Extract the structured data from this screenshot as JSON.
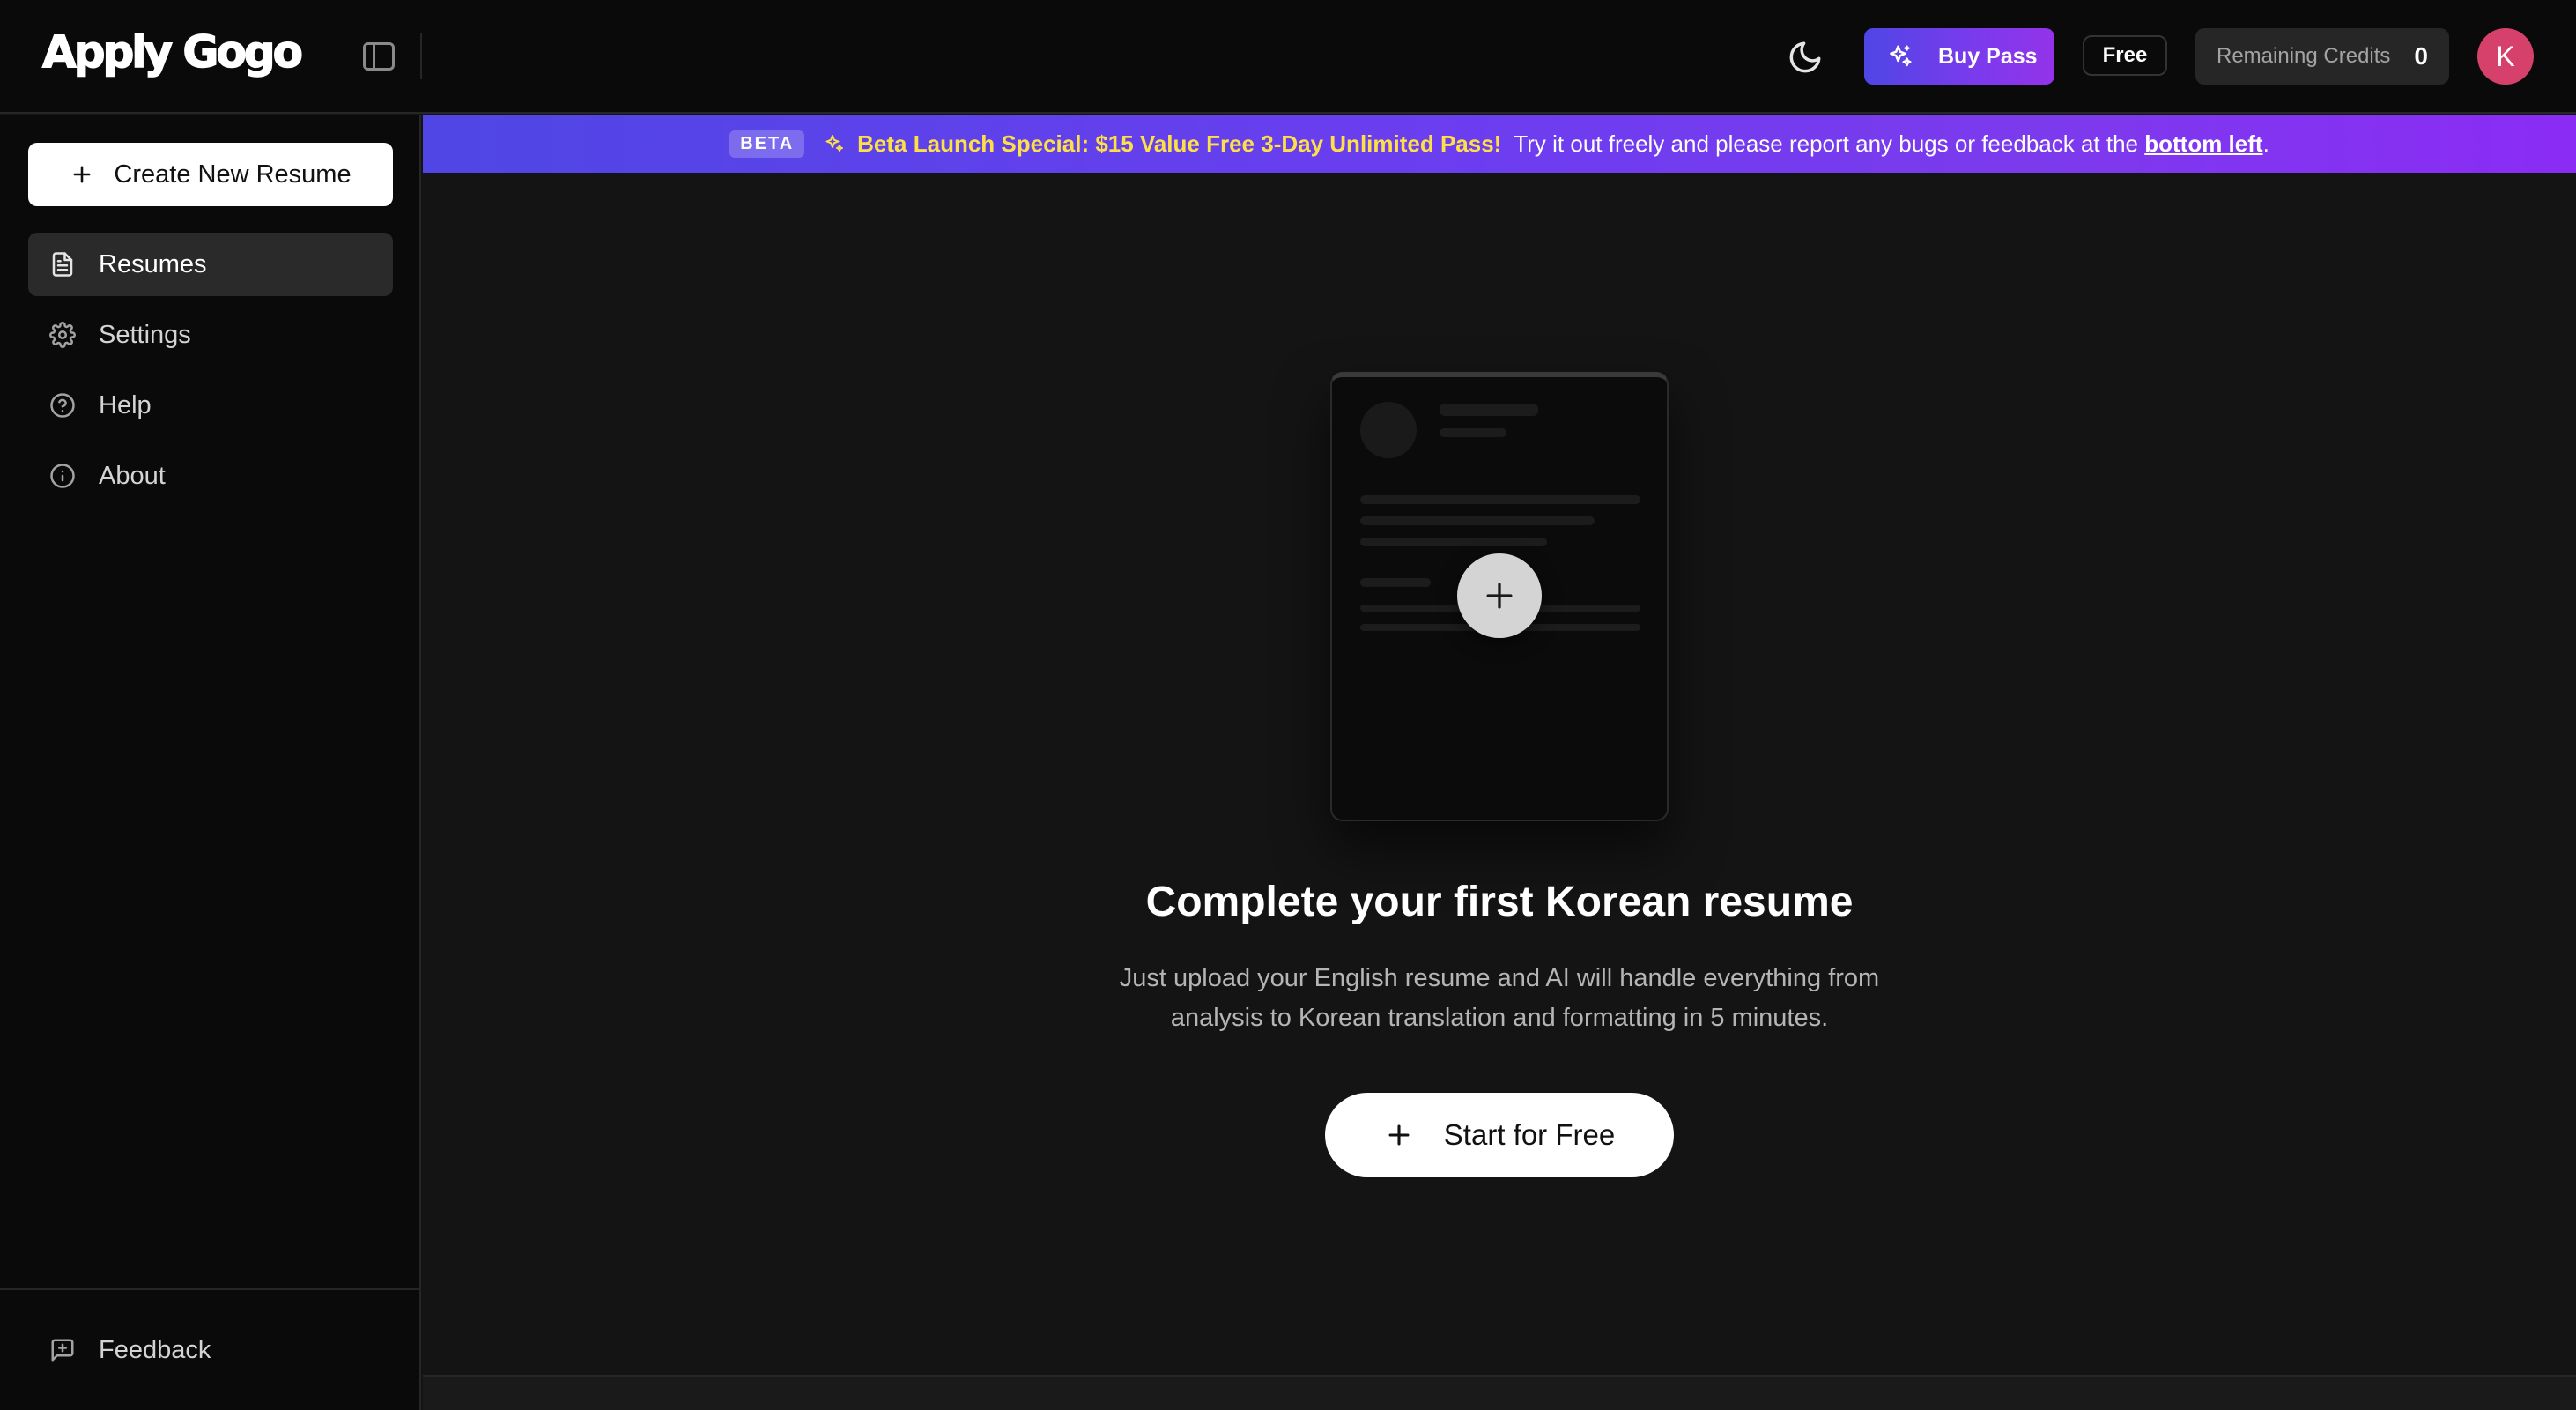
{
  "header": {
    "logo": "Apply Gogo",
    "buy_pass_label": "Buy Pass",
    "plan_label": "Free",
    "credits_label": "Remaining Credits",
    "credits_value": "0",
    "avatar_initial": "K",
    "icons": [
      "sidebar-toggle-icon",
      "moon-icon",
      "sparkles-icon"
    ]
  },
  "sidebar": {
    "create_label": "Create New Resume",
    "items": [
      {
        "label": "Resumes",
        "icon": "document-icon",
        "active": true
      },
      {
        "label": "Settings",
        "icon": "gear-icon",
        "active": false
      },
      {
        "label": "Help",
        "icon": "help-circle-icon",
        "active": false
      },
      {
        "label": "About",
        "icon": "info-icon",
        "active": false
      }
    ],
    "feedback_label": "Feedback"
  },
  "banner": {
    "tag": "BETA",
    "promo": "Beta Launch Special: $15 Value Free 3-Day Unlimited Pass!",
    "text": "Try it out freely and please report any bugs or feedback at the",
    "link": "bottom left",
    "end": "."
  },
  "main": {
    "title": "Complete your first Korean resume",
    "desc_line1": "Just upload your English resume and AI will handle everything from",
    "desc_line2": "analysis to Korean translation and formatting in 5 minutes.",
    "cta_label": "Start for Free"
  },
  "colors": {
    "accent_gradient_start": "#4f46e5",
    "accent_gradient_end": "#9333ea",
    "promo_text": "#fde047",
    "avatar_bg": "#d6416b"
  }
}
